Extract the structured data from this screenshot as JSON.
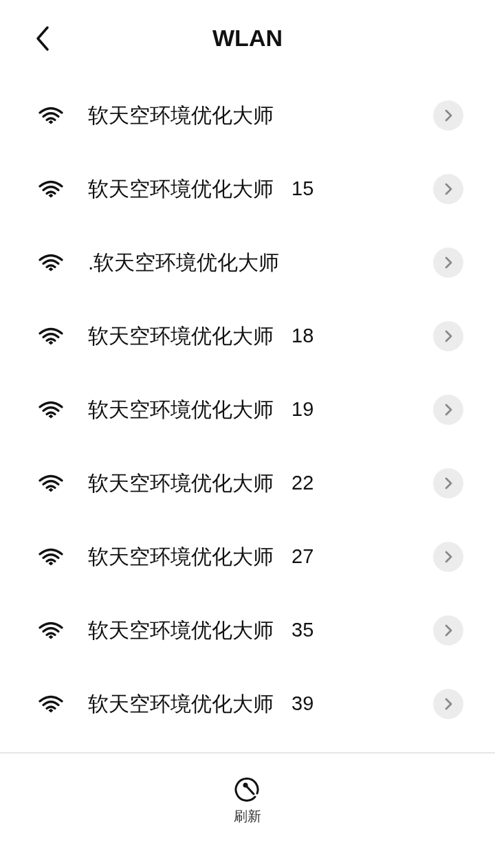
{
  "header": {
    "title": "WLAN"
  },
  "networks": [
    {
      "name": "软天空环境优化大师"
    },
    {
      "name": "软天空环境优化大师",
      "suffix": "15"
    },
    {
      "name": ".软天空环境优化大师"
    },
    {
      "name": "软天空环境优化大师",
      "suffix": "18"
    },
    {
      "name": "软天空环境优化大师",
      "suffix": "19"
    },
    {
      "name": "软天空环境优化大师",
      "suffix": "22"
    },
    {
      "name": "软天空环境优化大师",
      "suffix": "27"
    },
    {
      "name": "软天空环境优化大师",
      "suffix": "35"
    },
    {
      "name": "软天空环境优化大师",
      "suffix": "39"
    }
  ],
  "bottom_bar": {
    "refresh_label": "刷新"
  }
}
